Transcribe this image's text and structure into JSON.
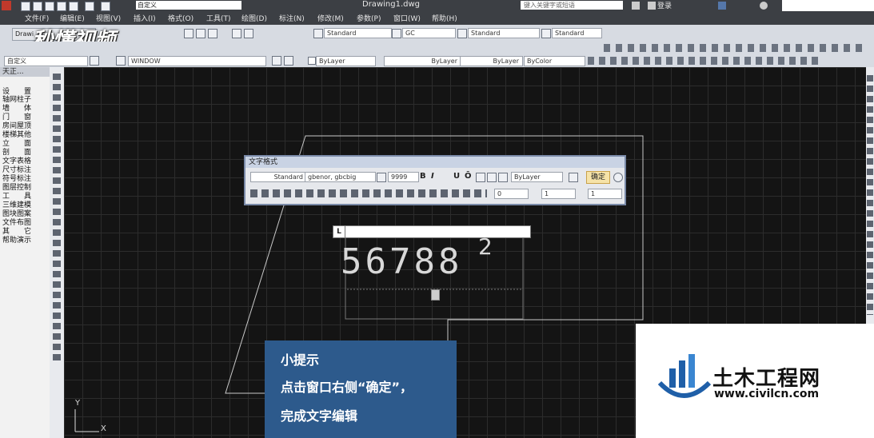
{
  "titlebar": {
    "workspace": "自定义",
    "document": "Drawing1.dwg",
    "search_placeholder": "键入关键字或短语",
    "login": "登录"
  },
  "menu": [
    "文件(F)",
    "编辑(E)",
    "视图(V)",
    "插入(I)",
    "格式(O)",
    "工具(T)",
    "绘图(D)",
    "标注(N)",
    "修改(M)",
    "参数(P)",
    "窗口(W)",
    "帮助(H)"
  ],
  "tab": {
    "label": "Drawi"
  },
  "watermark": "秒懂视频",
  "styles": {
    "text_style": "Standard",
    "dim_style": "GC",
    "table_style": "Standard",
    "mleader_style": "Standard"
  },
  "row3": {
    "workspace": "自定义",
    "layer": "WINDOW",
    "color": "ByLayer",
    "linetype": "ByLayer",
    "lineweight": "ByLayer",
    "plotstyle": "ByColor"
  },
  "left_panel": {
    "header": "天正...",
    "items": [
      "设　　置",
      "轴网柱子",
      "墙　　体",
      "门　　窗",
      "房间屋顶",
      "楼梯其他",
      "立　　面",
      "剖　　面",
      "文字表格",
      "尺寸标注",
      "符号标注",
      "图层控制",
      "工　　具",
      "三维建模",
      "图块图案",
      "文件布图",
      "其　　它",
      "帮助演示"
    ]
  },
  "text_format": {
    "title": "文字格式",
    "style": "Standard",
    "font": "gbenor, gbcbig",
    "height": "9999",
    "color": "ByLayer",
    "ok": "确定",
    "oblique": "0",
    "tracking": "1",
    "width_factor": "1",
    "bold": "B",
    "italic": "I",
    "underline": "U",
    "overline": "Ō"
  },
  "mtext": {
    "main": "56788",
    "superscript": "2"
  },
  "tip": {
    "title": "小提示",
    "line1": "点击窗口右侧“确定”，",
    "line2": "完成文字编辑"
  },
  "logo": {
    "name": "土木工程网",
    "url": "www.civilcn.com"
  },
  "ucs": {
    "x": "X",
    "y": "Y"
  },
  "colors": {
    "canvas": "#141414",
    "tip_bg": "#2d5a8c",
    "ok_bg": "#f6e3a8"
  }
}
